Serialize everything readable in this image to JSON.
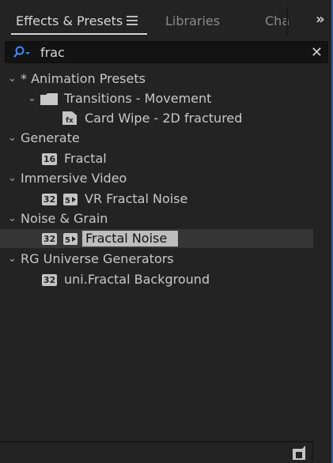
{
  "tabs": [
    {
      "label": "Effects & Presets",
      "active": true
    },
    {
      "label": "Libraries",
      "active": false
    },
    {
      "label": "Cha",
      "active": false
    }
  ],
  "search": {
    "value": "frac",
    "placeholder": ""
  },
  "tree": [
    {
      "type": "group",
      "label": "* Animation Presets",
      "expanded": true
    },
    {
      "type": "folder",
      "label": "Transitions - Movement",
      "expanded": true
    },
    {
      "type": "preset",
      "label": "Card Wipe - 2D fractured",
      "icon": "ffx-preset-icon"
    },
    {
      "type": "group",
      "label": "Generate",
      "expanded": true
    },
    {
      "type": "effect",
      "label": "Fractal",
      "badges": [
        "16"
      ]
    },
    {
      "type": "group",
      "label": "Immersive Video",
      "expanded": true
    },
    {
      "type": "effect",
      "label": "VR Fractal Noise",
      "badges": [
        "32",
        "gpu"
      ]
    },
    {
      "type": "group",
      "label": "Noise & Grain",
      "expanded": true
    },
    {
      "type": "effect",
      "label": "Fractal Noise",
      "badges": [
        "32",
        "gpu"
      ],
      "selected": true
    },
    {
      "type": "group",
      "label": "RG Universe Generators",
      "expanded": true
    },
    {
      "type": "effect",
      "label": "uni.Fractal Background",
      "badges": [
        "32"
      ]
    }
  ],
  "colors": {
    "accent": "#1f5fbf",
    "background": "#232323",
    "selected_row": "#363636"
  }
}
